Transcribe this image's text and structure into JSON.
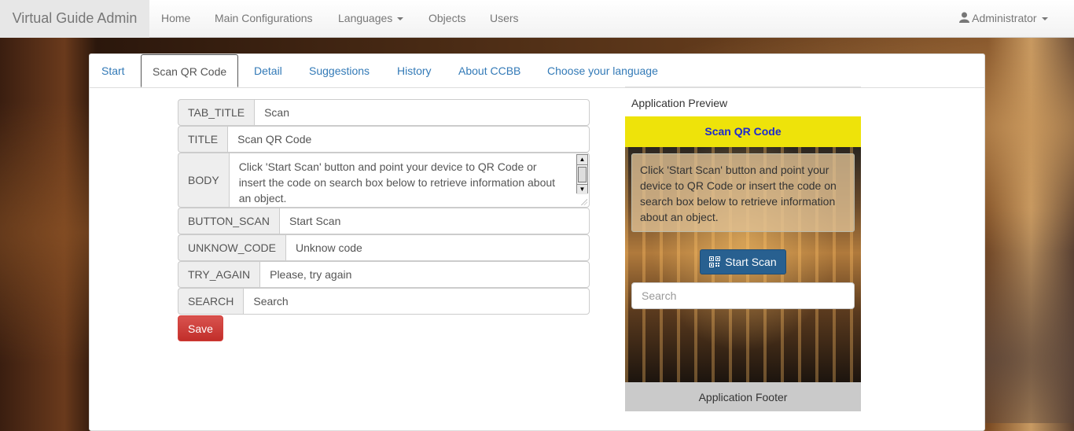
{
  "navbar": {
    "brand": "Virtual Guide Admin",
    "items": [
      "Home",
      "Main Configurations",
      "Languages",
      "Objects",
      "Users"
    ],
    "user": "Administrator"
  },
  "tabs": [
    "Start",
    "Scan QR Code",
    "Detail",
    "Suggestions",
    "History",
    "About CCBB",
    "Choose your language"
  ],
  "active_tab": "Scan QR Code",
  "form": {
    "fields": [
      {
        "key": "TAB_TITLE",
        "value": "Scan"
      },
      {
        "key": "TITLE",
        "value": "Scan QR Code"
      },
      {
        "key": "BODY",
        "value": "Click 'Start Scan' button and point your device to QR Code or insert the code on search box below to retrieve information about an object."
      },
      {
        "key": "BUTTON_SCAN",
        "value": "Start Scan"
      },
      {
        "key": "UNKNOW_CODE",
        "value": "Unknow code"
      },
      {
        "key": "TRY_AGAIN",
        "value": "Please, try again"
      },
      {
        "key": "SEARCH",
        "value": "Search"
      }
    ],
    "save_label": "Save"
  },
  "preview": {
    "title": "Application Preview",
    "header": "Scan QR Code",
    "body_text": "Click 'Start Scan' button and point your device to QR Code or insert the code on search box below to retrieve information about an object.",
    "scan_button": "Start Scan",
    "search_placeholder": "Search",
    "footer": "Application Footer"
  },
  "colors": {
    "app_header_bg": "#eee30a",
    "app_header_text": "#1d2ad0",
    "save_button": "#d9534f",
    "scan_button": "#286090",
    "link": "#337ab7"
  }
}
